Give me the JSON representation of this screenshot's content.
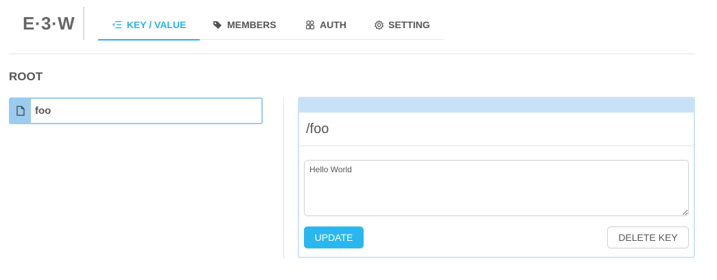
{
  "app": {
    "logo": "E·3·W"
  },
  "nav": {
    "tabs": [
      {
        "label": "KEY / VALUE",
        "icon": "list-icon",
        "active": true
      },
      {
        "label": "MEMBERS",
        "icon": "tag-icon",
        "active": false
      },
      {
        "label": "AUTH",
        "icon": "users-icon",
        "active": false
      },
      {
        "label": "SETTING",
        "icon": "gear-icon",
        "active": false
      }
    ]
  },
  "tree": {
    "title": "ROOT",
    "items": [
      {
        "name": "foo",
        "icon": "file-icon",
        "selected": true
      }
    ]
  },
  "editor": {
    "key": "/foo",
    "value": "Hello World",
    "update_label": "UPDATE",
    "delete_label": "DELETE KEY"
  },
  "colors": {
    "accent": "#2ab1ea",
    "selection": "#9ccbf0",
    "panel_header": "#c9e1f6"
  }
}
